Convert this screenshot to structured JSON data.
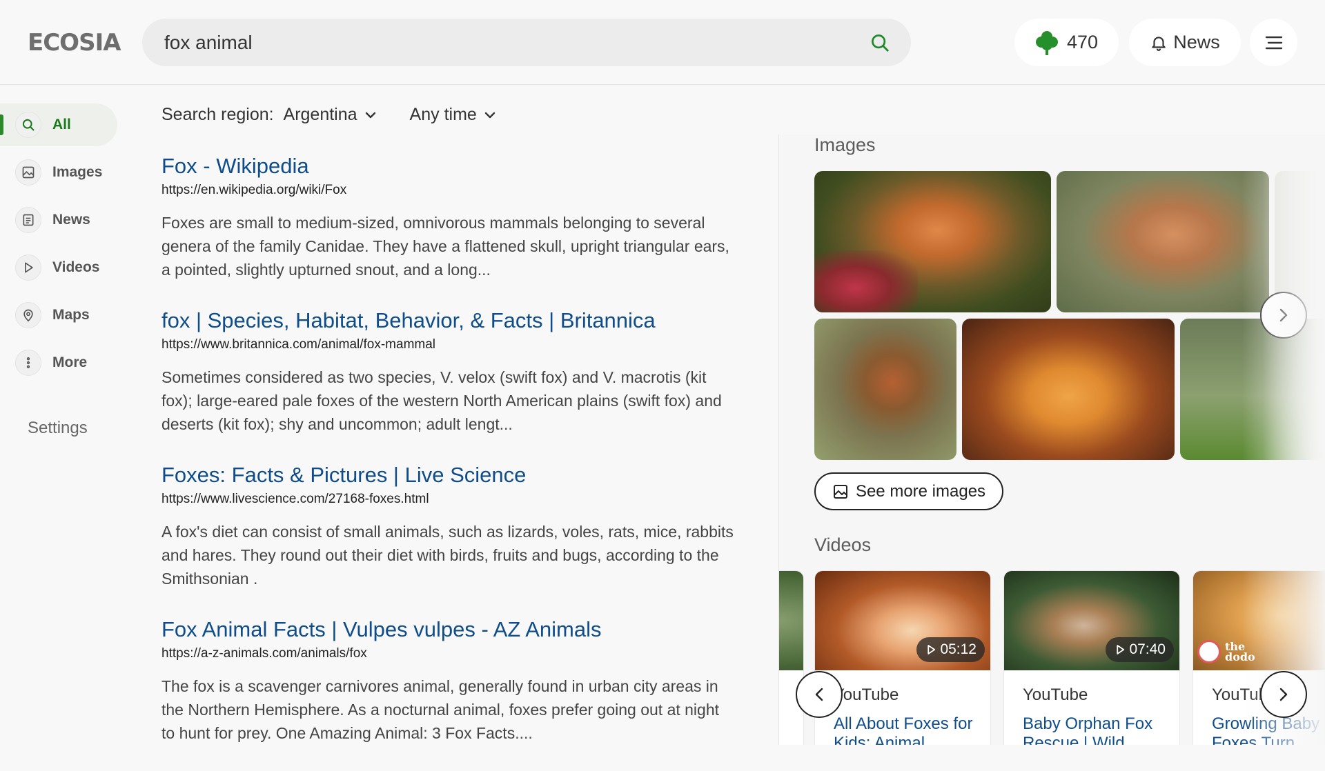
{
  "header": {
    "logo": "ECOSIA",
    "search_value": "fox animal",
    "tree_count": "470",
    "news_label": "News"
  },
  "nav": {
    "items": [
      {
        "label": "All",
        "icon": "search-icon",
        "active": true
      },
      {
        "label": "Images",
        "icon": "image-icon"
      },
      {
        "label": "News",
        "icon": "news-icon"
      },
      {
        "label": "Videos",
        "icon": "play-icon"
      },
      {
        "label": "Maps",
        "icon": "map-pin-icon"
      },
      {
        "label": "More",
        "icon": "more-vertical-icon"
      }
    ],
    "settings_label": "Settings"
  },
  "filters": {
    "region_label": "Search region:",
    "region_value": "Argentina",
    "time_value": "Any time"
  },
  "results": [
    {
      "title": "Fox - Wikipedia",
      "url": "https://en.wikipedia.org/wiki/Fox",
      "snippet": "Foxes are small to medium-sized, omnivorous mammals belonging to several genera of the family Canidae. They have a flattened skull, upright triangular ears, a pointed, slightly upturned snout, and a long..."
    },
    {
      "title": "fox | Species, Habitat, Behavior, & Facts | Britannica",
      "url": "https://www.britannica.com/animal/fox-mammal",
      "snippet": "Sometimes considered as two species, V. velox (swift fox) and V. macrotis (kit fox); large-eared pale foxes of the western North American plains (swift fox) and deserts (kit fox); shy and uncommon; adult lengt..."
    },
    {
      "title": "Foxes: Facts & Pictures | Live Science",
      "url": "https://www.livescience.com/27168-foxes.html",
      "snippet": "A fox's diet can consist of small animals, such as lizards, voles, rats, mice, rabbits and hares. They round out their diet with birds, fruits and bugs, according to the Smithsonian ."
    },
    {
      "title": "Fox Animal Facts | Vulpes vulpes - AZ Animals",
      "url": "https://a-z-animals.com/animals/fox",
      "snippet": "The fox is a scavenger carnivores animal, generally found in urban city areas in the Northern Hemisphere. As a nocturnal animal, foxes prefer going out at night to hunt for prey. One Amazing Animal: 3 Fox Facts...."
    }
  ],
  "panel": {
    "images_title": "Images",
    "see_more_label": "See more images",
    "videos_title": "Videos",
    "videos": [
      {
        "duration": "05:12",
        "source": "YouTube",
        "title": "All About Foxes for Kids: Animal"
      },
      {
        "duration": "07:40",
        "source": "YouTube",
        "title": "Baby Orphan Fox Rescue | Wild"
      },
      {
        "duration": "",
        "source": "YouTube",
        "title": "Growling Baby Foxes Turn",
        "badge": "the dodo"
      }
    ]
  },
  "colors": {
    "link": "#0f4d8a",
    "accent_green": "#2a8a2a",
    "tree_green": "#25902b"
  }
}
